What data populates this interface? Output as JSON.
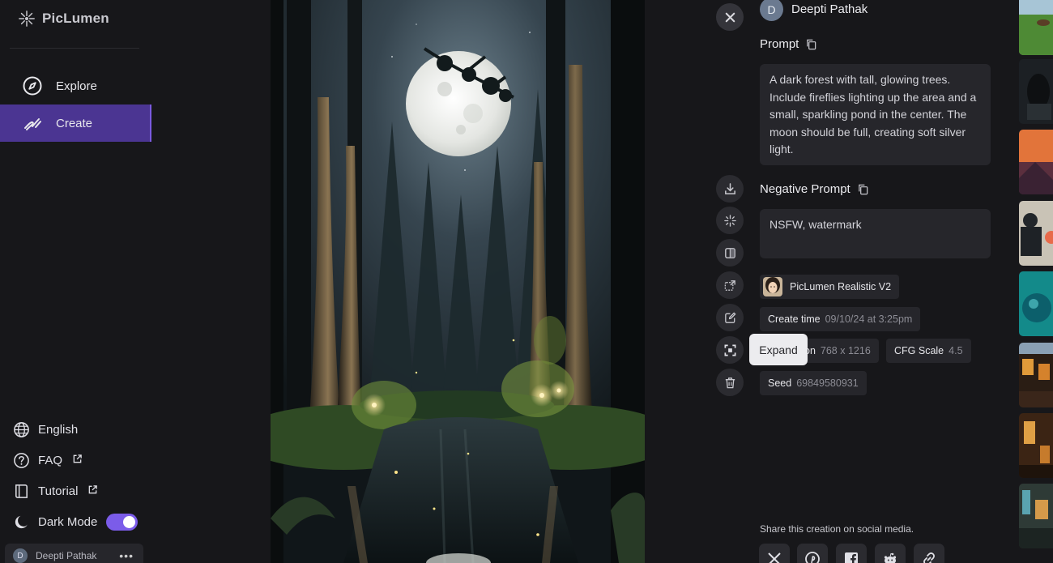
{
  "app": {
    "name": "PicLumen"
  },
  "sidebar": {
    "nav": [
      {
        "label": "Explore",
        "icon": "compass-icon"
      },
      {
        "label": "Create",
        "icon": "brush-icon",
        "active": true
      }
    ],
    "bottom": {
      "language": "English",
      "faq": "FAQ",
      "tutorial": "Tutorial",
      "dark_mode": "Dark Mode",
      "dark_mode_on": true
    },
    "user": {
      "initial": "D",
      "name": "Deepti Pathak",
      "menu": "•••"
    }
  },
  "image": {
    "alt": "Moonlit forest with glowing trees, fireflies and pond"
  },
  "actions": {
    "close": "close-icon",
    "download": "download-icon",
    "vary": "sparkle-icon",
    "compare": "compare-icon",
    "upscale": "upscale-icon",
    "edit": "edit-icon",
    "expand": "expand-icon",
    "delete": "trash-icon",
    "tooltip": "Expand"
  },
  "details": {
    "author": {
      "initial": "D",
      "name": "Deepti Pathak"
    },
    "prompt_title": "Prompt",
    "prompt_text": " A dark forest with tall, glowing trees. Include fireflies lighting up the area and a small, sparkling pond in the center. The moon should be full, creating soft silver light.",
    "negative_title": "Negative Prompt",
    "negative_text": "NSFW, watermark",
    "model": "PicLumen Realistic V2",
    "create_time_label": "Create time",
    "create_time_value": "09/10/24 at 3:25pm",
    "resolution_label": "Resolution",
    "resolution_visible": "on",
    "resolution_value": "768 x 1216",
    "cfg_label": "CFG Scale",
    "cfg_value": "4.5",
    "seed_label": "Seed",
    "seed_value": "69849580931",
    "share_text": "Share this creation on social media."
  },
  "share": [
    "x-icon",
    "pinterest-icon",
    "facebook-icon",
    "reddit-icon",
    "link-icon"
  ],
  "colors": {
    "accent": "#7b5ce9",
    "active_nav": "#4b3592",
    "background": "#17171a",
    "surface": "#26262b"
  }
}
